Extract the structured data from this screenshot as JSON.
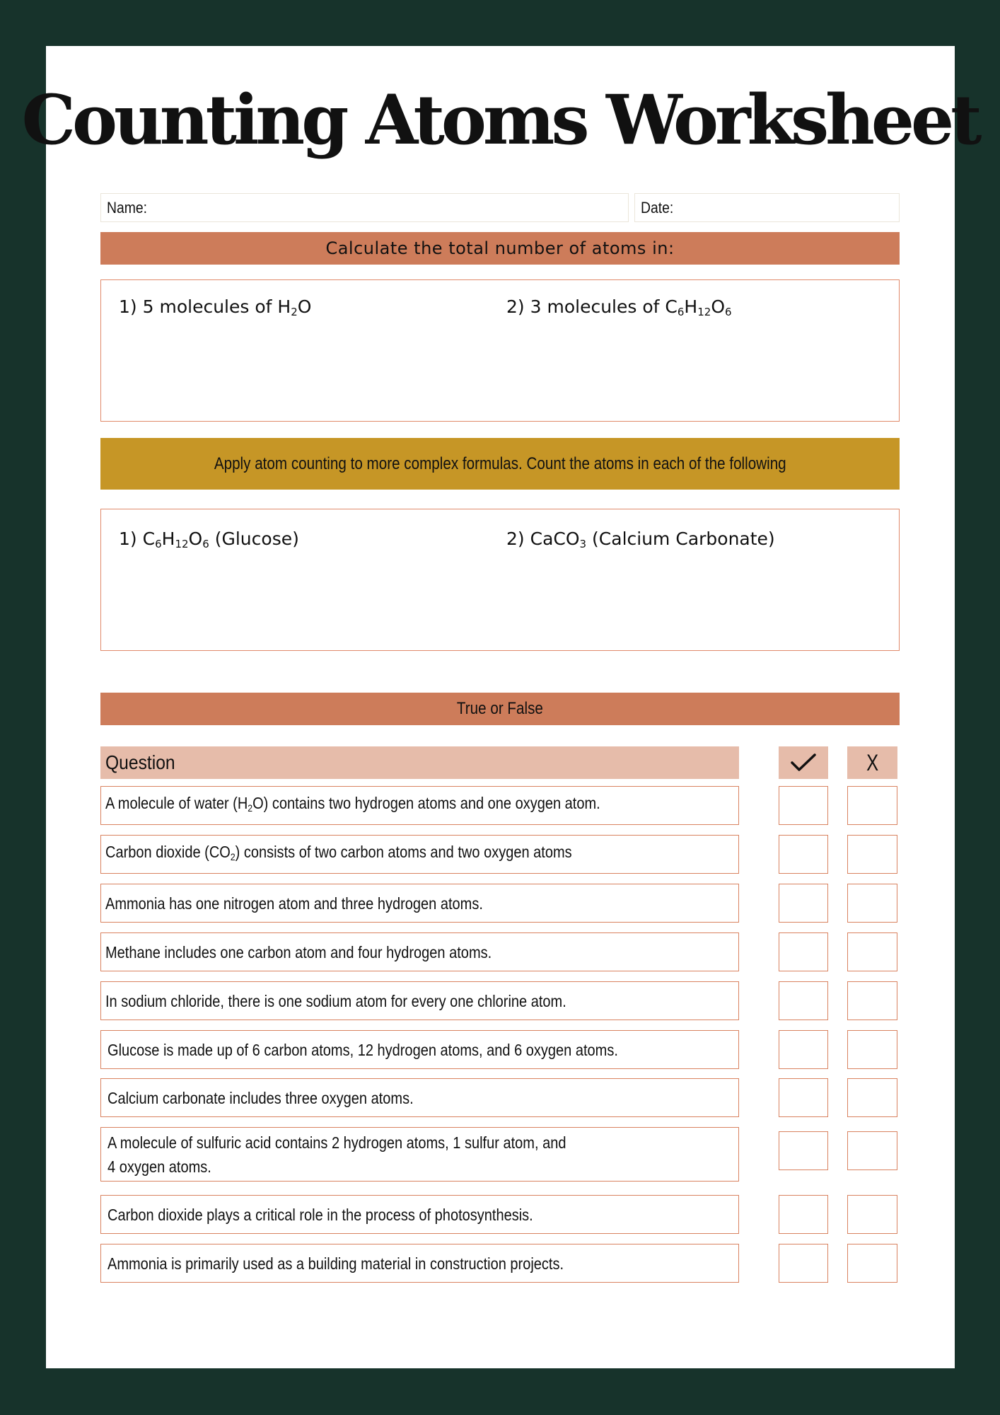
{
  "title": "Counting Atoms Worksheet",
  "header_fields": {
    "name_label": "Name:",
    "date_label": "Date:"
  },
  "section1": {
    "heading": "Calculate the total number of atoms in:",
    "problems": [
      {
        "number": "1)",
        "text": "5 molecules of ",
        "formula": [
          [
            "H",
            "2"
          ],
          [
            "O",
            ""
          ]
        ]
      },
      {
        "number": "2)",
        "text": "3 molecules of ",
        "formula": [
          [
            "C",
            "6"
          ],
          [
            "H",
            "12"
          ],
          [
            "O",
            "6"
          ]
        ]
      }
    ]
  },
  "section2": {
    "heading": "Apply atom counting to more complex formulas. Count the atoms in each of the following",
    "problems": [
      {
        "number": "1)",
        "formula": [
          [
            "C",
            "6"
          ],
          [
            "H",
            "12"
          ],
          [
            "O",
            "6"
          ]
        ],
        "name": "(Glucose)"
      },
      {
        "number": "2)",
        "formula": [
          [
            "CaCO",
            "3"
          ]
        ],
        "name": "(Calcium Carbonate)"
      }
    ]
  },
  "section3": {
    "heading": "True or False",
    "column_question": "Question",
    "column_true_icon": "check-icon",
    "column_false_label": "X",
    "questions": [
      {
        "pre": "A molecule of water (H",
        "sub": "2",
        "post": "O) contains two hydrogen atoms and one oxygen atom."
      },
      {
        "pre": "Carbon dioxide (CO",
        "sub": "2",
        "post": ") consists of two carbon atoms and two oxygen atoms"
      },
      {
        "pre": "Ammonia has one nitrogen atom and three hydrogen atoms.",
        "sub": "",
        "post": ""
      },
      {
        "pre": "Methane includes one carbon atom and four hydrogen atoms.",
        "sub": "",
        "post": ""
      },
      {
        "pre": "In sodium chloride, there is one sodium atom for every one chlorine atom.",
        "sub": "",
        "post": ""
      },
      {
        "pre": "Glucose is made up of 6 carbon atoms, 12 hydrogen atoms, and 6 oxygen atoms.",
        "sub": "",
        "post": ""
      },
      {
        "pre": "Calcium carbonate includes three oxygen atoms.",
        "sub": "",
        "post": ""
      },
      {
        "pre": "A molecule of sulfuric acid contains 2 hydrogen atoms, 1 sulfur atom, and 4 oxygen atoms.",
        "sub": "",
        "post": ""
      },
      {
        "pre": "Carbon dioxide plays a critical role in the process of photosynthesis.",
        "sub": "",
        "post": ""
      },
      {
        "pre": "Ammonia is primarily used as a building material in construction projects.",
        "sub": "",
        "post": ""
      }
    ]
  },
  "colors": {
    "background": "#17332b",
    "orange_banner": "#cd7c5a",
    "gold_banner": "#c69626",
    "table_header": "#e6bcaa",
    "box_border": "#d9825f"
  }
}
